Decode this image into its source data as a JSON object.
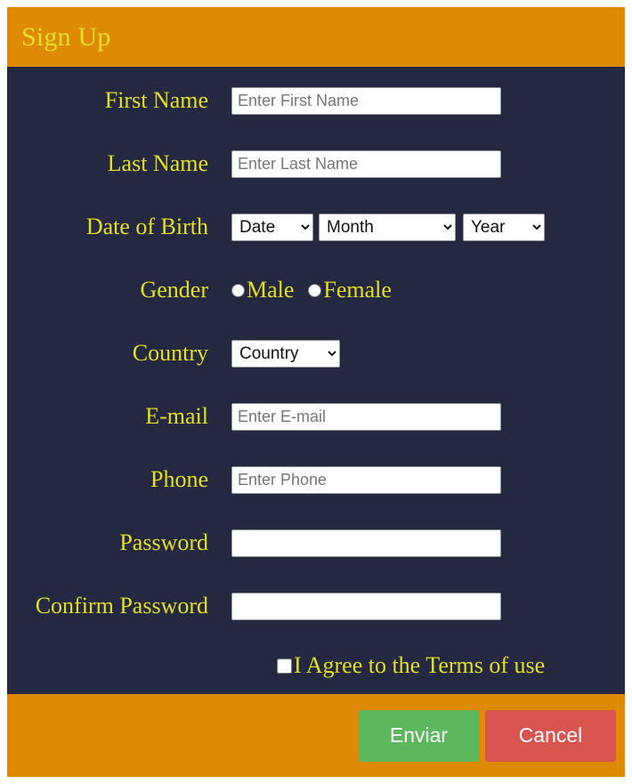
{
  "header": {
    "title": "Sign Up"
  },
  "form": {
    "fields": [
      {
        "label": "First Name",
        "placeholder": "Enter First Name",
        "value": ""
      },
      {
        "label": "Last Name",
        "placeholder": "Enter Last Name",
        "value": ""
      }
    ],
    "dob": {
      "label": "Date of Birth",
      "date_selected": "Date",
      "month_selected": "Month",
      "year_selected": "Year"
    },
    "gender": {
      "label": "Gender",
      "options": [
        {
          "label": "Male",
          "checked": false
        },
        {
          "label": "Female",
          "checked": false
        }
      ]
    },
    "country": {
      "label": "Country",
      "selected": "Country"
    },
    "email": {
      "label": "E-mail",
      "placeholder": "Enter E-mail",
      "value": ""
    },
    "phone": {
      "label": "Phone",
      "placeholder": "Enter Phone",
      "value": ""
    },
    "password": {
      "label": "Password",
      "placeholder": "",
      "value": ""
    },
    "confirm_password": {
      "label": "Confirm Password",
      "placeholder": "",
      "value": ""
    },
    "terms": {
      "label": "I Agree to the Terms of use",
      "checked": false
    }
  },
  "footer": {
    "submit_label": "Enviar",
    "cancel_label": "Cancel"
  },
  "colors": {
    "header_bar": "#df8a07",
    "body_background": "#242840",
    "label_text": "#e3e024",
    "submit_button": "#5cb85c",
    "cancel_button": "#d9534f"
  }
}
